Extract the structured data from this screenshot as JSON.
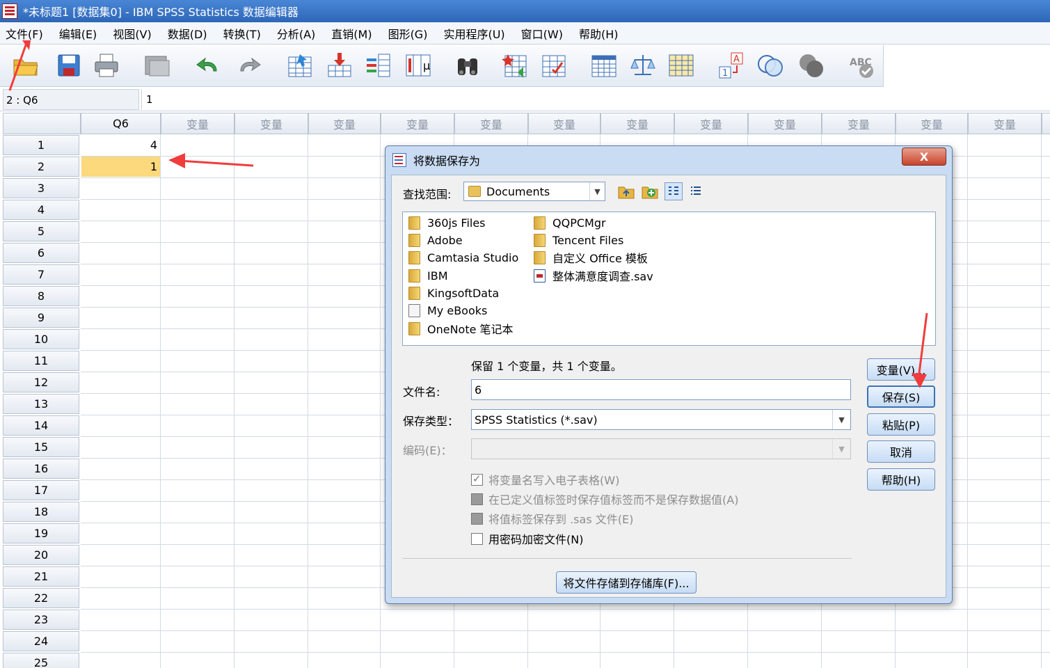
{
  "window": {
    "title": "*未标题1 [数据集0] - IBM SPSS Statistics 数据编辑器"
  },
  "menu": [
    "文件(F)",
    "编辑(E)",
    "视图(V)",
    "数据(D)",
    "转换(T)",
    "分析(A)",
    "直销(M)",
    "图形(G)",
    "实用程序(U)",
    "窗口(W)",
    "帮助(H)"
  ],
  "toolbar_icons": [
    "open-icon",
    "save-icon",
    "print-icon",
    "dialog-recall-icon",
    "undo-icon",
    "redo-icon",
    "goto-case-icon",
    "goto-variable-icon",
    "variables-icon",
    "run-descriptives-icon",
    "find-icon",
    "insert-cases-icon",
    "insert-variable-icon",
    "split-file-icon",
    "weight-cases-icon",
    "select-cases-icon",
    "value-labels-icon",
    "use-variable-sets-icon",
    "show-all-variables-icon",
    "spell-check-icon"
  ],
  "cellbar": {
    "ref": "2 : Q6",
    "value": "1"
  },
  "grid": {
    "columns": [
      "Q6",
      "变量",
      "变量",
      "变量",
      "变量",
      "变量",
      "变量",
      "变量",
      "变量",
      "变量",
      "变量",
      "变量",
      "变量"
    ],
    "rows": [
      "1",
      "2",
      "3",
      "4",
      "5",
      "6",
      "7",
      "8",
      "9",
      "10",
      "11",
      "12",
      "13",
      "14",
      "15",
      "16",
      "17",
      "18",
      "19",
      "20",
      "21",
      "22",
      "23",
      "24",
      "25"
    ],
    "values": [
      "4",
      "1"
    ],
    "selected_row": 2
  },
  "dialog": {
    "title": "将数据保存为",
    "close": "X",
    "look_in_label": "查找范围:",
    "look_in_value": "Documents",
    "files_col1": [
      "360js Files",
      "Adobe",
      "Camtasia Studio",
      "IBM",
      "KingsoftData",
      "My eBooks",
      "OneNote 笔记本"
    ],
    "files_col2": [
      "QQPCMgr",
      "Tencent Files",
      "自定义 Office 模板",
      "整体满意度调查.sav"
    ],
    "keep_info": "保留 1 个变量，共 1 个变量。",
    "filename_label": "文件名:",
    "filename_value": "6",
    "type_label": "保存类型：",
    "type_value": "SPSS Statistics (*.sav)",
    "encoding_label": "编码(E)：",
    "checks": [
      {
        "label": "将变量名写入电子表格(W)",
        "state": "checked-disabled"
      },
      {
        "label": "在已定义值标签时保存值标签而不是保存数据值(A)",
        "state": "disabled"
      },
      {
        "label": "将值标签保存到 .sas 文件(E)",
        "state": "disabled"
      },
      {
        "label": "用密码加密文件(N)",
        "state": "unchecked"
      }
    ],
    "buttons": {
      "variables": "变量(V)...",
      "save": "保存(S)",
      "paste": "粘贴(P)",
      "cancel": "取消",
      "help": "帮助(H)"
    },
    "repository_button": "将文件存储到存储库(F)..."
  },
  "colors": {
    "accent": "#2d67b8",
    "selected_cell": "#fbd97c",
    "annotation_arrow": "#f03c3c"
  }
}
